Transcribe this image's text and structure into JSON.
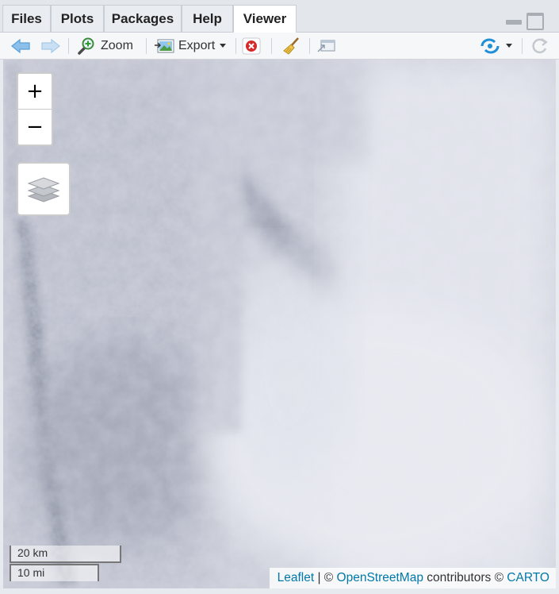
{
  "tabs": [
    {
      "label": "Files"
    },
    {
      "label": "Plots"
    },
    {
      "label": "Packages"
    },
    {
      "label": "Help"
    },
    {
      "label": "Viewer"
    }
  ],
  "active_tab": "Viewer",
  "toolbar": {
    "zoom_label": "Zoom",
    "export_label": "Export"
  },
  "map": {
    "zoom_in_label": "+",
    "zoom_out_label": "−",
    "scale_km": "20 km",
    "scale_mi": "10 mi",
    "attribution": {
      "leaflet": "Leaflet",
      "sep": " | © ",
      "osm": "OpenStreetMap",
      "contributors": " contributors © ",
      "carto": "CARTO"
    }
  },
  "colors": {
    "link": "#0078a8",
    "back_arrow": "#5aa0dc",
    "stop_red": "#d42a2a",
    "sync_blue": "#1f8fd6"
  }
}
